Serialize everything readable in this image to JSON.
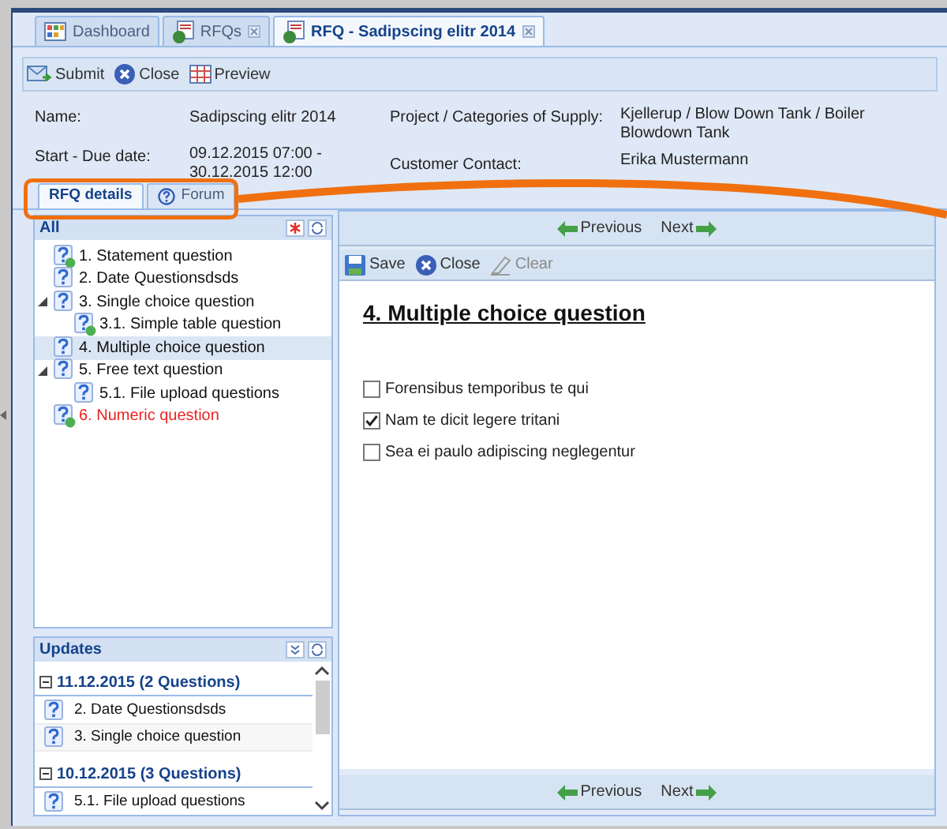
{
  "tabs": [
    {
      "label": "Dashboard",
      "closable": false,
      "selected": false
    },
    {
      "label": "RFQs",
      "closable": true,
      "selected": false
    },
    {
      "label": "RFQ - Sadipscing elitr 2014",
      "closable": true,
      "selected": true
    }
  ],
  "toolbar": [
    "Submit",
    "Close",
    "Preview"
  ],
  "info": {
    "name_label": "Name:",
    "name": "Sadipscing elitr 2014",
    "date_label": "Start - Due date:",
    "date": "09.12.2015 07:00 - 30.12.2015 12:00",
    "project_label": "Project / Categories of Supply:",
    "project": "Kjellerup / Blow Down Tank / Boiler Blowdown Tank",
    "contact_label": "Customer Contact:",
    "contact": "Erika Mustermann"
  },
  "detail_tabs": [
    {
      "label": "RFQ details",
      "selected": true
    },
    {
      "label": "Forum",
      "selected": false
    }
  ],
  "tree": {
    "title": "All",
    "items": [
      {
        "label": "1. Statement question",
        "answered": true,
        "invalid": false,
        "selected": false
      },
      {
        "label": "2. Date Questionsdsds",
        "answered": false,
        "invalid": false,
        "selected": false
      },
      {
        "label": "3. Single choice question",
        "answered": false,
        "invalid": false,
        "selected": false,
        "expanded": true,
        "children": [
          {
            "label": "3.1. Simple table question",
            "answered": true,
            "invalid": false,
            "selected": false
          }
        ]
      },
      {
        "label": "4. Multiple choice question",
        "answered": false,
        "invalid": false,
        "selected": true
      },
      {
        "label": "5. Free text question",
        "answered": false,
        "invalid": false,
        "selected": false,
        "expanded": true,
        "children": [
          {
            "label": "5.1. File upload questions",
            "answered": false,
            "invalid": false,
            "selected": false
          }
        ]
      },
      {
        "label": "6. Numeric question",
        "answered": true,
        "invalid": true,
        "selected": false
      }
    ]
  },
  "updates": {
    "title": "Updates",
    "groups": [
      {
        "label": "11.12.2015 (2 Questions)",
        "expanded": true,
        "items": [
          "2. Date Questionsdsds",
          "3. Single choice question"
        ]
      },
      {
        "label": "10.12.2015 (3 Questions)",
        "expanded": true,
        "items": [
          "5.1. File upload questions"
        ]
      }
    ]
  },
  "nav": {
    "previous": "Previous",
    "next": "Next"
  },
  "question_toolbar": [
    {
      "label": "Save",
      "disabled": false
    },
    {
      "label": "Close",
      "disabled": false
    },
    {
      "label": "Clear",
      "disabled": true
    }
  ],
  "question": {
    "title": "4. Multiple choice question",
    "options": [
      {
        "label": "Forensibus temporibus te qui",
        "checked": false
      },
      {
        "label": "Nam te dicit legere tritani",
        "checked": true
      },
      {
        "label": "Sea ei paulo adipiscing neglegentur",
        "checked": false
      }
    ]
  },
  "bottom_nav": {
    "previous": "Previous",
    "next": "Next"
  }
}
